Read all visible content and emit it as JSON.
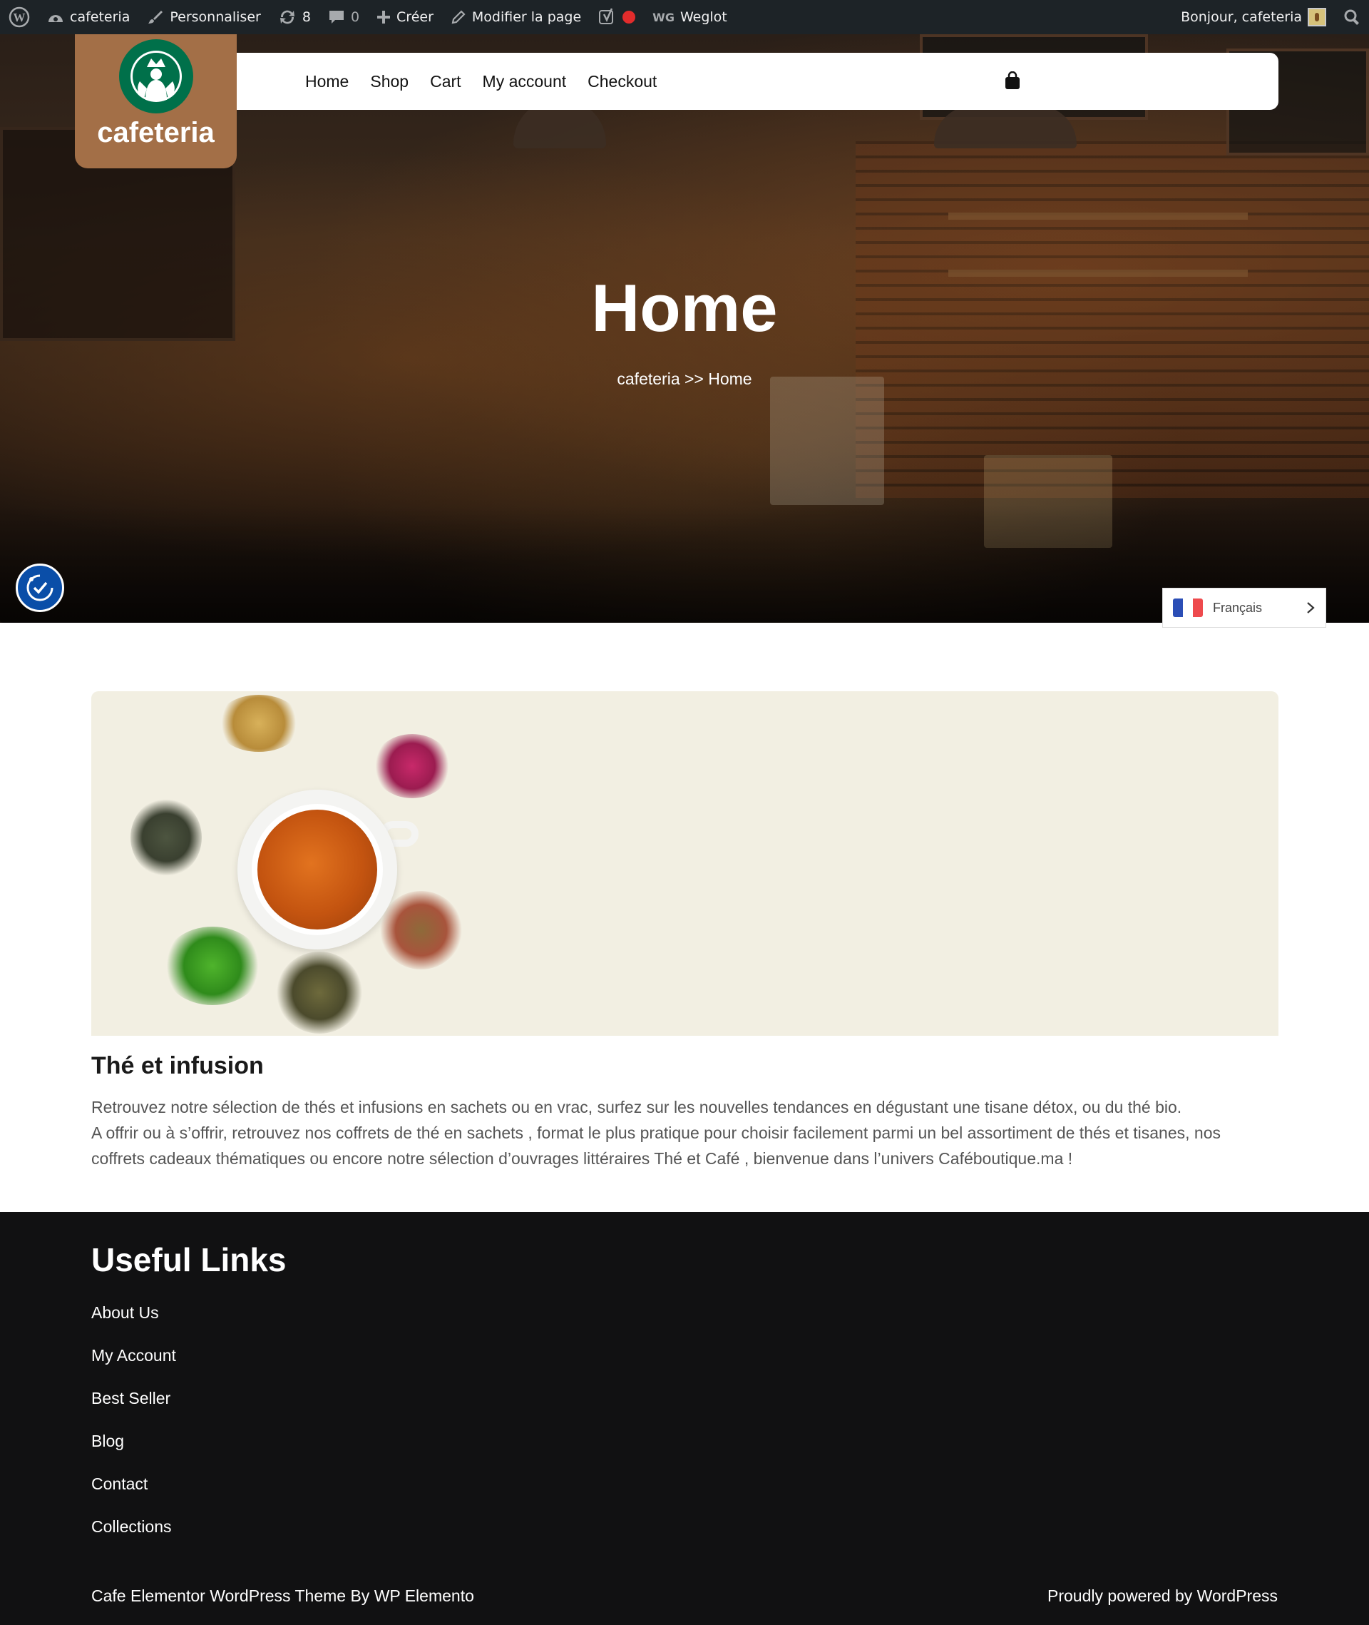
{
  "admin_bar": {
    "site_name": "cafeteria",
    "customize_label": "Personnaliser",
    "updates_count": "8",
    "comments_count": "0",
    "new_label": "Créer",
    "edit_page_label": "Modifier la page",
    "weglot_prefix": "WG",
    "weglot_label": "Weglot",
    "greeting": "Bonjour, cafeteria"
  },
  "header": {
    "logo_text": "cafeteria",
    "nav": [
      "Home",
      "Shop",
      "Cart",
      "My account",
      "Checkout"
    ]
  },
  "hero": {
    "title": "Home",
    "breadcrumb": "cafeteria >> Home"
  },
  "language_switcher": {
    "current": "Français"
  },
  "content": {
    "title": "Thé et infusion",
    "paragraph_1": "Retrouvez notre sélection de thés et infusions en sachets ou en vrac, surfez sur les nouvelles tendances en dégustant une tisane détox, ou du thé bio.",
    "paragraph_2": "A offrir ou à s’offrir, retrouvez nos coffrets de thé en sachets , format le plus pratique pour choisir facilement parmi un bel assortiment de thés et tisanes, nos coffrets cadeaux thématiques ou encore notre sélection d’ouvrages littéraires Thé et Café , bienvenue dans l’univers Caféboutique.ma !"
  },
  "footer": {
    "heading": "Useful Links",
    "links": [
      "About Us",
      "My Account",
      "Best Seller",
      "Blog",
      "Contact",
      "Collections"
    ],
    "credit": "Cafe Elementor WordPress Theme By WP Elemento",
    "powered": "Proudly powered by WordPress"
  },
  "colors": {
    "admin_bar": "#1d2327",
    "logo_bg": "#a36f47",
    "footer_bg": "#111112",
    "accessibility_btn": "#0a4ea8",
    "banner_bg": "#f2efe2"
  }
}
